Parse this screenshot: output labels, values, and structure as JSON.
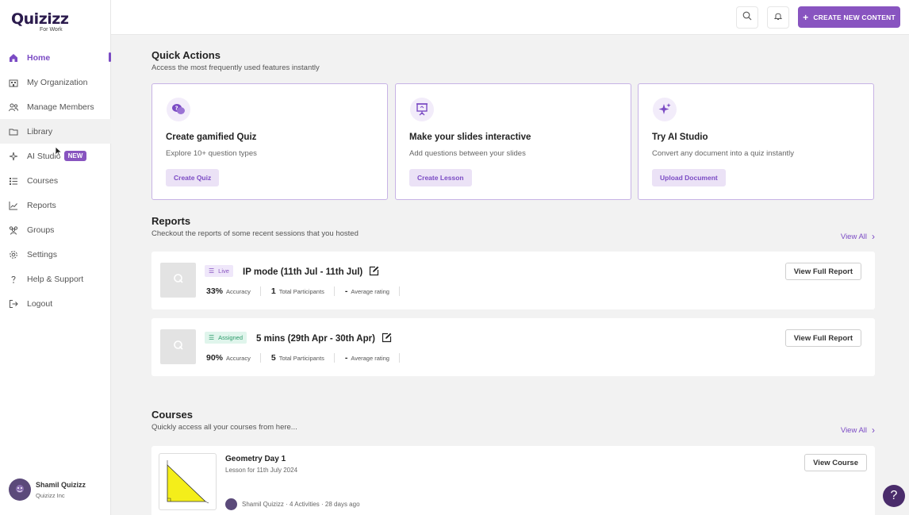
{
  "brand": {
    "logo": "Quizizz",
    "sub": "For Work",
    "accent": "#8854c0"
  },
  "sidebar": {
    "items": [
      {
        "label": "Home",
        "icon": "home-icon"
      },
      {
        "label": "My Organization",
        "icon": "building-icon"
      },
      {
        "label": "Manage Members",
        "icon": "members-icon"
      },
      {
        "label": "Library",
        "icon": "folder-icon"
      },
      {
        "label": "AI Studio",
        "icon": "sparkle-icon",
        "badge": "NEW"
      },
      {
        "label": "Courses",
        "icon": "list-icon"
      },
      {
        "label": "Reports",
        "icon": "chart-icon"
      },
      {
        "label": "Groups",
        "icon": "groups-icon"
      },
      {
        "label": "Settings",
        "icon": "gear-icon"
      },
      {
        "label": "Help & Support",
        "icon": "question-icon"
      },
      {
        "label": "Logout",
        "icon": "logout-icon"
      }
    ],
    "active": "Home",
    "user": {
      "name": "Shamil Quizizz",
      "org": "Quizizz Inc"
    }
  },
  "topbar": {
    "create_label": "CREATE NEW CONTENT"
  },
  "quick_actions": {
    "title": "Quick Actions",
    "subtitle": "Access the most frequently used features instantly",
    "cards": [
      {
        "title": "Create gamified Quiz",
        "desc": "Explore 10+ question types",
        "button": "Create Quiz",
        "icon": "quiz-chat-icon"
      },
      {
        "title": "Make your slides interactive",
        "desc": "Add questions between your slides",
        "button": "Create Lesson",
        "icon": "presentation-icon"
      },
      {
        "title": "Try AI Studio",
        "desc": "Convert any document into a quiz instantly",
        "button": "Upload Document",
        "icon": "sparkle-icon"
      }
    ]
  },
  "reports": {
    "title": "Reports",
    "subtitle": "Checkout the reports of some recent sessions that you hosted",
    "view_all": "View All",
    "items": [
      {
        "status": "Live",
        "title": "IP mode (11th Jul - 11th Jul)",
        "accuracy": "33%",
        "accuracy_label": "Accuracy",
        "participants": "1",
        "participants_label": "Total Participants",
        "rating": "-",
        "rating_label": "Average rating",
        "button": "View Full Report"
      },
      {
        "status": "Assigned",
        "title": "5 mins (29th Apr - 30th Apr)",
        "accuracy": "90%",
        "accuracy_label": "Accuracy",
        "participants": "5",
        "participants_label": "Total Participants",
        "rating": "-",
        "rating_label": "Average rating",
        "button": "View Full Report"
      }
    ]
  },
  "courses": {
    "title": "Courses",
    "subtitle": "Quickly access all your courses from here...",
    "view_all": "View All",
    "items": [
      {
        "title": "Geometry Day 1",
        "sub": "Lesson for 11th July 2024",
        "author": "Shamil Quizizz",
        "activities": "4 Activities",
        "age": "28 days ago",
        "button": "View Course"
      }
    ]
  },
  "help_fab": "?"
}
